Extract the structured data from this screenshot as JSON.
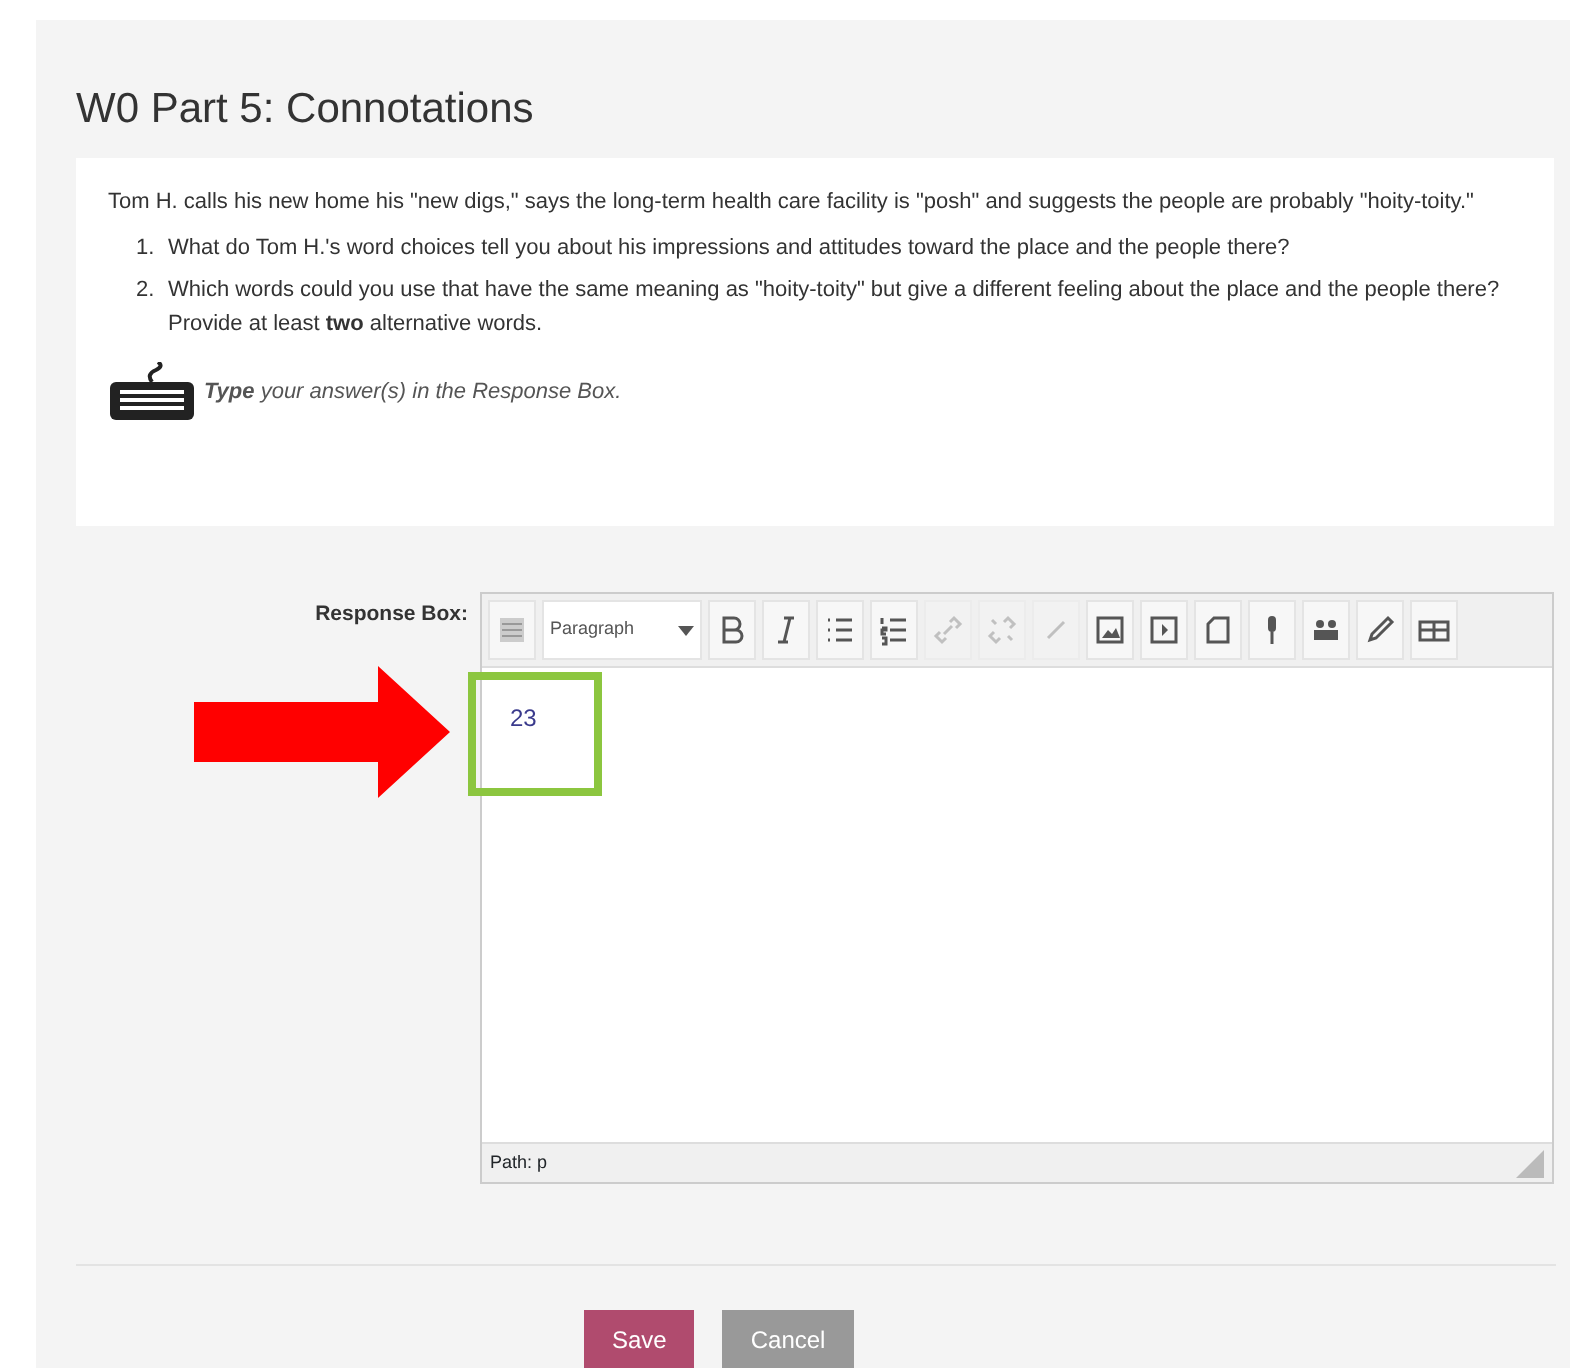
{
  "title": "W0 Part 5: Connotations",
  "prompt": {
    "intro": "Tom H. calls his new home his \"new digs,\" says the long-term health care facility is \"posh\" and suggests the people are probably \"hoity-toity.\"",
    "questions": [
      {
        "marker": "1.",
        "text": "What do Tom H.'s word choices tell you about his impressions and attitudes toward the place and the people there?"
      },
      {
        "marker": "2.",
        "text": "Which words could you use that have the same meaning as \"hoity-toity\" but give a different feeling about the place and the people there?  Provide at least **two** alternative words."
      }
    ],
    "instruction": "**Type** your answer(s) in the Response Box."
  },
  "response": {
    "label": "Response Box:",
    "format": "Paragraph",
    "value": "23",
    "path": "Path: p",
    "toolbar": [
      {
        "kind": "toggle",
        "disabled": false
      },
      {
        "kind": "format",
        "disabled": false
      },
      {
        "kind": "bold",
        "disabled": false
      },
      {
        "kind": "italic",
        "disabled": false
      },
      {
        "kind": "bullets",
        "disabled": false
      },
      {
        "kind": "numbers",
        "disabled": false
      },
      {
        "kind": "link",
        "disabled": true
      },
      {
        "kind": "unlink",
        "disabled": true
      },
      {
        "kind": "anchor",
        "disabled": true
      },
      {
        "kind": "image",
        "disabled": false
      },
      {
        "kind": "media",
        "disabled": false
      },
      {
        "kind": "file",
        "disabled": false
      },
      {
        "kind": "record",
        "disabled": false
      },
      {
        "kind": "people",
        "disabled": false
      },
      {
        "kind": "pen",
        "disabled": false
      },
      {
        "kind": "table",
        "disabled": false
      }
    ]
  },
  "buttons": [
    {
      "kind": "primary",
      "label": "Save"
    },
    {
      "kind": "secondary",
      "label": "Cancel"
    }
  ]
}
